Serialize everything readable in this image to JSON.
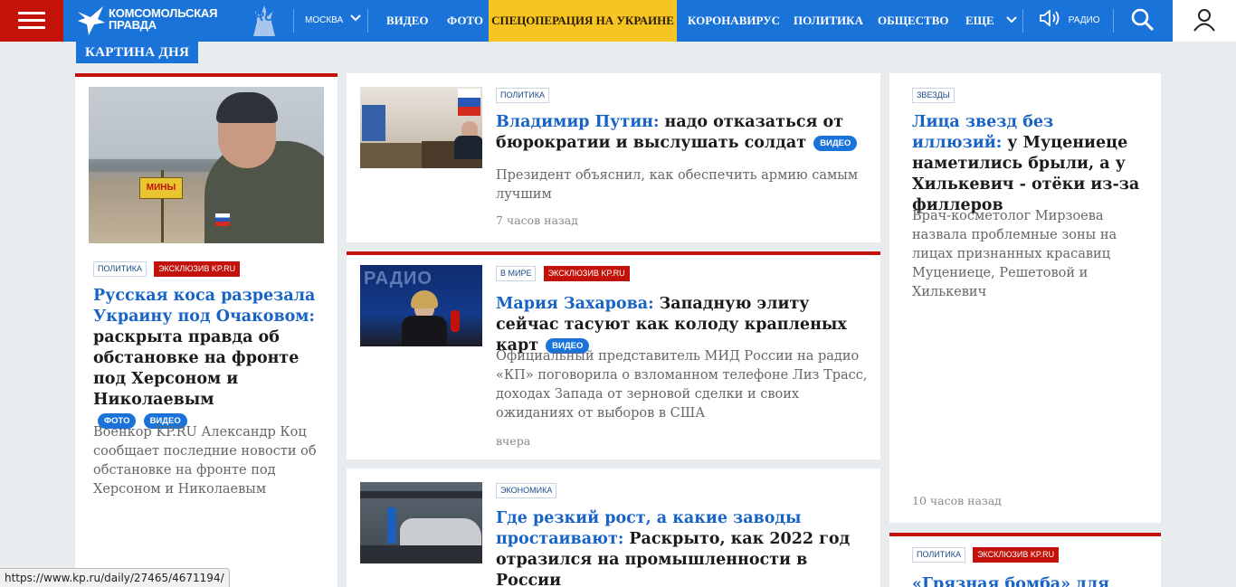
{
  "header": {
    "logo_line1": "КОМСОМОЛЬСКАЯ",
    "logo_line2": "ПРАВДА",
    "logo_ru": ".RU",
    "city": "МОСКВА",
    "nav": [
      "ВИДЕО",
      "ФОТО"
    ],
    "special": "СПЕЦОПЕРАЦИЯ НА УКРАИНЕ",
    "nav2": [
      "КОРОНАВИРУС",
      "ПОЛИТИКА",
      "ОБЩЕСТВО"
    ],
    "more": "ЕЩЕ",
    "radio": "РАДИО",
    "colors": {
      "brand_blue": "#1a73d9",
      "brand_red": "#c3120a",
      "special_yellow": "#f6c522"
    }
  },
  "section_label": "КАРТИНА ДНЯ",
  "main_story": {
    "tags": [
      "ПОЛИТИКА"
    ],
    "exclusive": "ЭКСКЛЮЗИВ KP.RU",
    "sign_text": "МИНЫ",
    "headline_blue": "Русская коса разрезала Украину под Очаковом:",
    "headline_rest": " раскрыта правда об обстановке на фронте под Херсоном и Николаевым",
    "badges": [
      "ФОТО",
      "ВИДЕО"
    ],
    "lead": "Военкор KP.RU Александр Коц сообщает последние новости об обстановке на фронте под Херсоном и Николаевым"
  },
  "stories": [
    {
      "tag": "ПОЛИТИКА",
      "headline_blue": "Владимир Путин:",
      "headline_rest": " надо отказаться от бюрократии и выслушать солдат",
      "badge": "ВИДЕО",
      "lead": "Президент объяснил, как обеспечить армию самым лучшим",
      "time": "7 часов назад"
    },
    {
      "tag": "В МИРЕ",
      "exclusive": "ЭКСКЛЮЗИВ KP.RU",
      "image_caption": "РАДИО",
      "headline_blue": "Мария Захарова:",
      "headline_rest": " Западную элиту сейчас тасуют как колоду крапленых карт",
      "badge": "ВИДЕО",
      "lead": "Официальный представитель МИД России на радио «КП» поговорила о взломанном телефоне Лиз Трасс, доходах Запада от зерновой сделки и своих ожиданиях от выборов в США",
      "time": "вчера"
    },
    {
      "tag": "ЭКОНОМИКА",
      "headline_blue": "Где резкий рост, а какие заводы простаивают:",
      "headline_rest": " Раскрыто, как 2022 год отразился на промышленности в России"
    }
  ],
  "side_story": {
    "tag": "ЗВЕЗДЫ",
    "headline_blue": "Лица звезд без иллюзий:",
    "headline_rest": " у Муцениеце наметились брыли, а у Хилькевич - отёки из-за филлеров",
    "lead": "Врач-косметолог Мирзоева назвала проблемные зоны на лицах признанных красавиц Муцениеце, Решетовой и Хилькевич",
    "time": "10 часов назад"
  },
  "side_story2": {
    "tag": "ПОЛИТИКА",
    "exclusive": "ЭКСКЛЮЗИВ KP.RU",
    "headline_blue": "«Грязная бомба» для"
  },
  "status_url": "https://www.kp.ru/daily/27465/4671194/"
}
